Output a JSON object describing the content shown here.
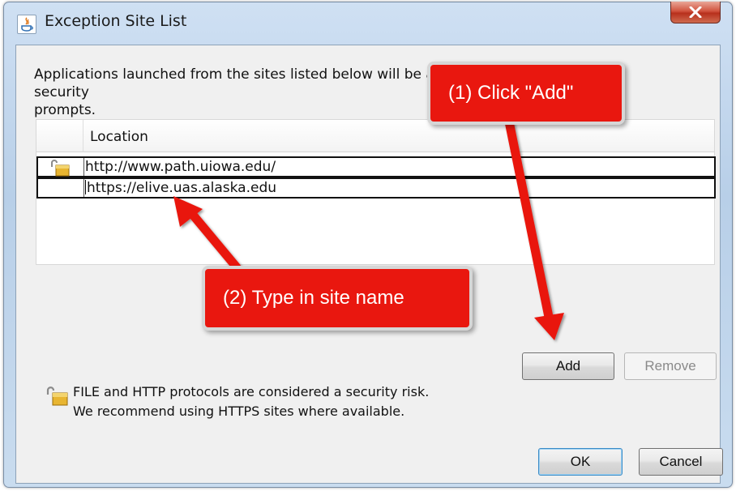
{
  "window": {
    "title": "Exception Site List"
  },
  "intro": {
    "line1_visible": "Applications launched from the sites listed below will be allowe",
    "line1_tail": "security",
    "line2": "prompts."
  },
  "table": {
    "header": "Location",
    "rows": [
      {
        "location": "http://www.path.uiowa.edu/",
        "icon": "unlocked-padlock-icon"
      },
      {
        "location": "https://elive.uas.alaska.edu",
        "icon": ""
      }
    ]
  },
  "buttons": {
    "add": "Add",
    "remove": "Remove",
    "ok": "OK",
    "cancel": "Cancel"
  },
  "warning": {
    "icon": "unlocked-padlock-icon",
    "line1": "FILE and HTTP protocols are considered a security risk.",
    "line2": "We recommend using HTTPS sites where available."
  },
  "annotations": {
    "step1": "(1) Click \"Add\"",
    "step2": "(2) Type in site name",
    "color": "#e9170f"
  }
}
